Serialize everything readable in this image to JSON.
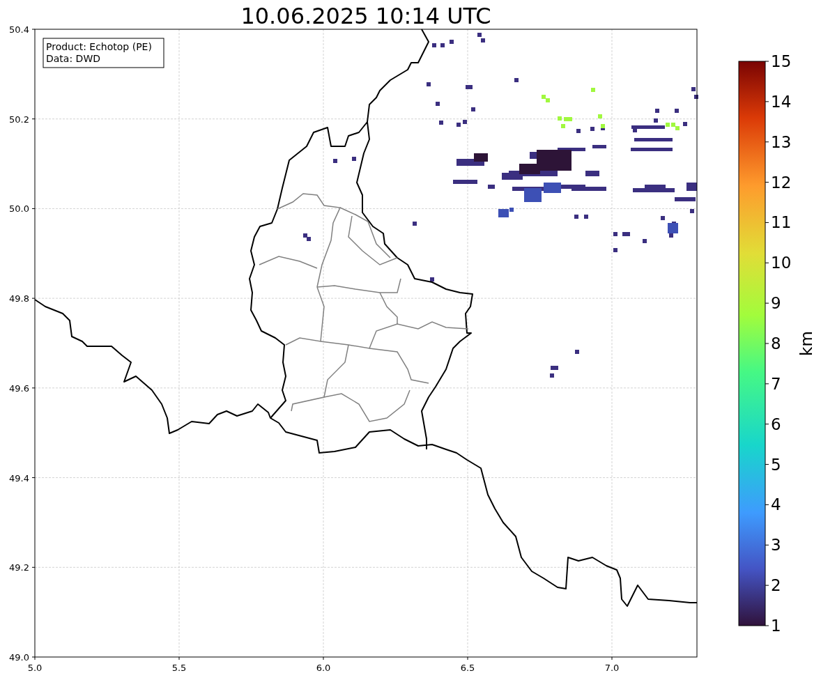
{
  "title": "10.06.2025 10:14 UTC",
  "info_box": [
    "Product: Echotop (PE)",
    "Data: DWD"
  ],
  "x_ticks": [
    "5.0",
    "5.5",
    "6.0",
    "6.5",
    "7.0"
  ],
  "y_ticks": [
    "50.4",
    "50.2",
    "50.0",
    "49.8",
    "49.6",
    "49.4",
    "49.2",
    "49.0"
  ],
  "colorbar": {
    "label": "km",
    "ticks": [
      "15",
      "14",
      "13",
      "12",
      "11",
      "10",
      "9",
      "8",
      "7",
      "6",
      "5",
      "4",
      "3",
      "2",
      "1"
    ]
  }
}
